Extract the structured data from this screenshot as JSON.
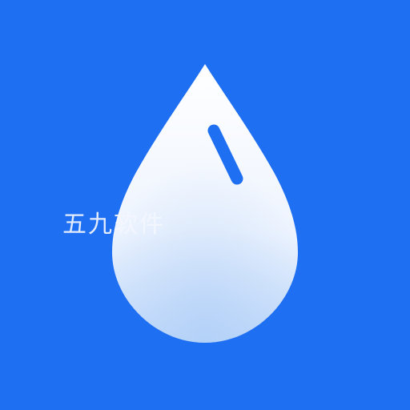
{
  "watermark": {
    "text": "五九软件"
  },
  "icon": {
    "name": "water-drop-icon",
    "background_color": "#1E6FF2",
    "drop_top_color": "#FFFFFF",
    "drop_bottom_color": "#BFD9FA",
    "highlight_color": "#1E6FF2"
  }
}
